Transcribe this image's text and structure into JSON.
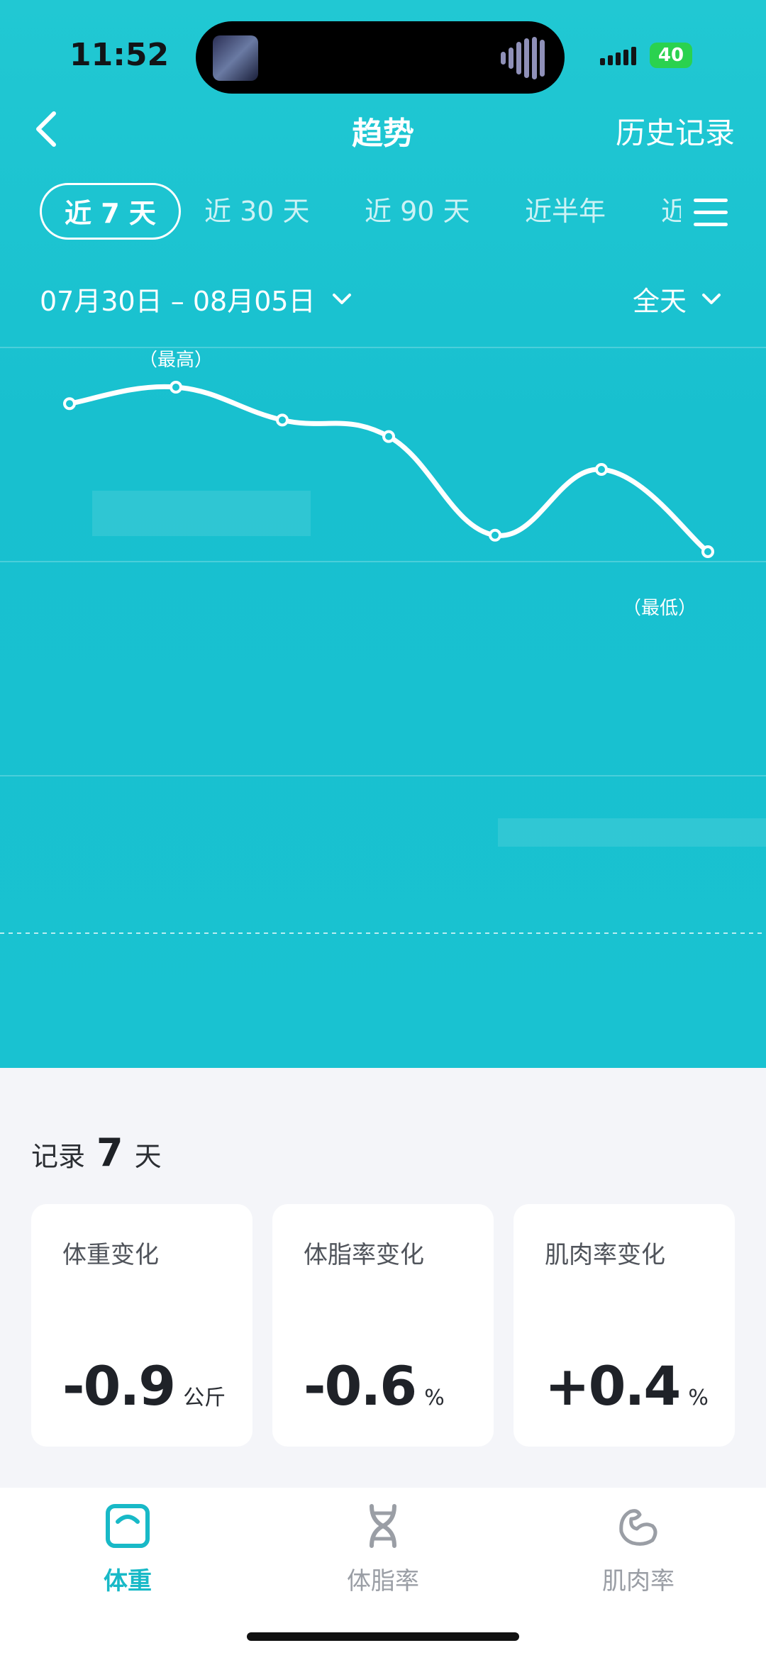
{
  "status_bar": {
    "time": "11:52",
    "battery": "40"
  },
  "nav": {
    "title": "趋势",
    "history": "历史记录"
  },
  "tabs": [
    {
      "label": "近 7 天",
      "active": true
    },
    {
      "label": "近 30 天",
      "active": false
    },
    {
      "label": "近 90 天",
      "active": false
    },
    {
      "label": "近半年",
      "active": false
    },
    {
      "label": "近",
      "active": false
    }
  ],
  "filters": {
    "date_range": "07月30日 – 08月05日",
    "time_of_day": "全天"
  },
  "chart": {
    "max_label": "（最高）",
    "min_label": "（最低）"
  },
  "chart_data": {
    "type": "line",
    "x": [
      1,
      2,
      3,
      4,
      5,
      6,
      7
    ],
    "values": [
      0.05,
      0.0,
      0.1,
      0.15,
      0.45,
      0.25,
      0.5
    ],
    "note_scale": "unlabeled"
  },
  "summary": {
    "prefix": "记录",
    "days": "7",
    "suffix": "天",
    "cards": [
      {
        "label": "体重变化",
        "value": "-0.9",
        "unit": "公斤"
      },
      {
        "label": "体脂率变化",
        "value": "-0.6",
        "unit": "%"
      },
      {
        "label": "肌肉率变化",
        "value": "+0.4",
        "unit": "%"
      }
    ]
  },
  "tabbar": [
    {
      "label": "体重",
      "icon": "scale-icon",
      "active": true
    },
    {
      "label": "体脂率",
      "icon": "dna-icon",
      "active": false
    },
    {
      "label": "肌肉率",
      "icon": "muscle-arm-icon",
      "active": false
    }
  ],
  "colors": {
    "accent": "#18b9c7",
    "hero_bg": "#1bc3d1"
  }
}
